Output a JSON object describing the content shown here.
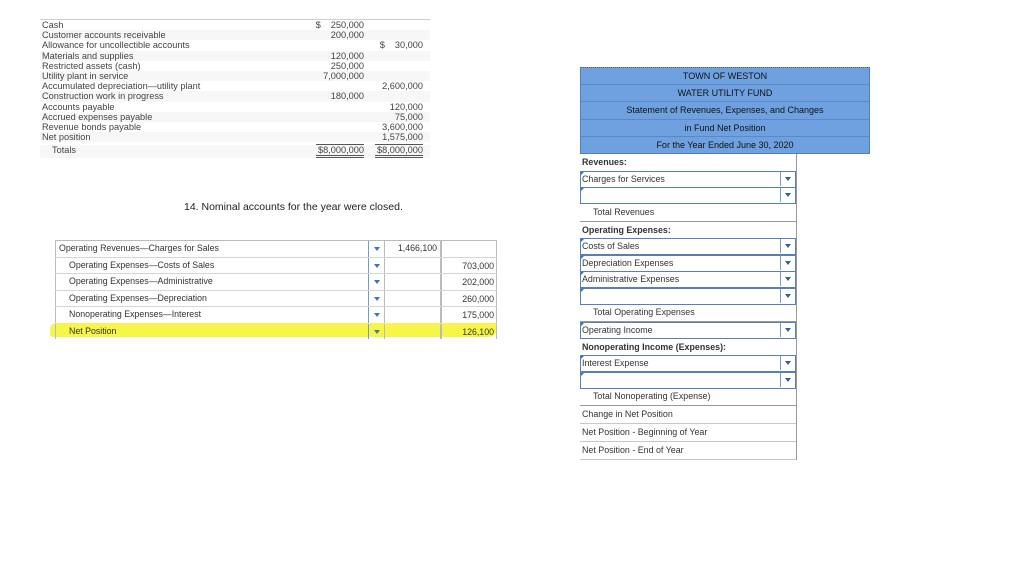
{
  "trial_balance": {
    "rows": [
      {
        "label": "Cash",
        "debit": "250,000",
        "debit_symbol": "$",
        "credit": ""
      },
      {
        "label": "Customer accounts receivable",
        "debit": "200,000",
        "credit": ""
      },
      {
        "label": "Allowance for uncollectible accounts",
        "debit": "",
        "credit": "30,000",
        "credit_symbol": "$"
      },
      {
        "label": "Materials and supplies",
        "debit": "120,000",
        "credit": ""
      },
      {
        "label": "Restricted assets (cash)",
        "debit": "250,000",
        "credit": ""
      },
      {
        "label": "Utility plant in service",
        "debit": "7,000,000",
        "credit": ""
      },
      {
        "label": "Accumulated depreciation—utility plant",
        "debit": "",
        "credit": "2,600,000"
      },
      {
        "label": "Construction work in progress",
        "debit": "180,000",
        "credit": ""
      },
      {
        "label": "Accounts payable",
        "debit": "",
        "credit": "120,000"
      },
      {
        "label": "Accrued expenses payable",
        "debit": "",
        "credit": "75,000"
      },
      {
        "label": "Revenue bonds payable",
        "debit": "",
        "credit": "3,600,000"
      },
      {
        "label": "Net position",
        "debit": "",
        "credit": "1,575,000"
      }
    ],
    "totals": {
      "label": "Totals",
      "debit": "$8,000,000",
      "credit": "$8,000,000"
    }
  },
  "caption": "14. Nominal accounts for the year were closed.",
  "closing_entry": {
    "rows": [
      {
        "account": "Operating Revenues—Charges for Sales",
        "debit": "1,466,100",
        "credit": "",
        "indent": false,
        "highlight": false
      },
      {
        "account": "Operating Expenses—Costs of Sales",
        "debit": "",
        "credit": "703,000",
        "indent": true,
        "highlight": false
      },
      {
        "account": "Operating Expenses—Administrative",
        "debit": "",
        "credit": "202,000",
        "indent": true,
        "highlight": false
      },
      {
        "account": "Operating Expenses—Depreciation",
        "debit": "",
        "credit": "260,000",
        "indent": true,
        "highlight": false
      },
      {
        "account": "Nonoperating Expenses—Interest",
        "debit": "",
        "credit": "175,000",
        "indent": true,
        "highlight": false
      },
      {
        "account": "Net Position",
        "debit": "",
        "credit": "126,100",
        "indent": true,
        "highlight": true
      }
    ],
    "highlight_color": "#f6f64a"
  },
  "statement": {
    "header": [
      "TOWN OF WESTON",
      "WATER UTILITY FUND",
      "Statement of Revenues, Expenses, and Changes",
      "in Fund Net Position",
      "For the Year Ended June 30, 2020"
    ],
    "header_color": "#6fa1e0",
    "rows": [
      {
        "type": "section",
        "label": "Revenues:"
      },
      {
        "type": "select",
        "label": "Charges for Services"
      },
      {
        "type": "select",
        "label": ""
      },
      {
        "type": "total",
        "label": "Total Revenues"
      },
      {
        "type": "section",
        "label": "Operating Expenses:"
      },
      {
        "type": "select",
        "label": "Costs of Sales"
      },
      {
        "type": "select",
        "label": "Depreciation Expenses"
      },
      {
        "type": "select",
        "label": "Administrative Expenses"
      },
      {
        "type": "select",
        "label": ""
      },
      {
        "type": "total",
        "label": "Total Operating Expenses"
      },
      {
        "type": "select",
        "label": "Operating Income"
      },
      {
        "type": "section",
        "label": "Nonoperating Income (Expenses):"
      },
      {
        "type": "select",
        "label": "Interest Expense"
      },
      {
        "type": "select",
        "label": ""
      },
      {
        "type": "total",
        "label": "Total Nonoperating (Expense)"
      },
      {
        "type": "plain",
        "label": "Change in Net Position"
      },
      {
        "type": "plain",
        "label": "Net Position - Beginning of Year"
      },
      {
        "type": "plain",
        "label": "Net Position - End of Year"
      }
    ]
  }
}
